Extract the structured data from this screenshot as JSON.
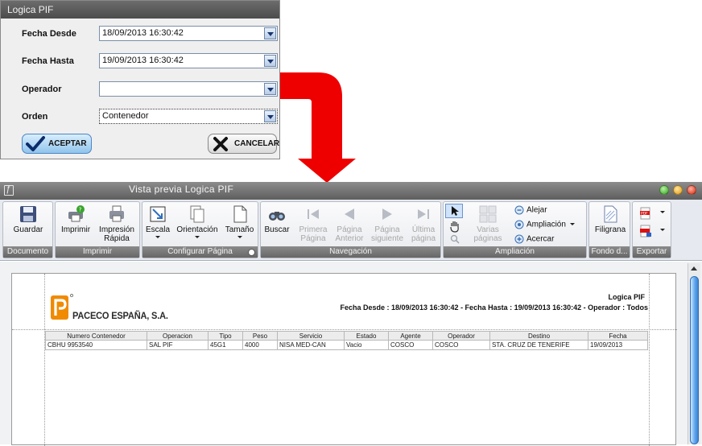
{
  "dialog": {
    "title": "Logica PIF",
    "fields": [
      {
        "label": "Fecha Desde",
        "value": "18/09/2013 16:30:42"
      },
      {
        "label": "Fecha Hasta",
        "value": "19/09/2013 16:30:42"
      },
      {
        "label": "Operador",
        "value": ""
      },
      {
        "label": "Orden",
        "value": "Contenedor"
      }
    ],
    "accept_label": "ACEPTAR",
    "cancel_label": "CANCELAR"
  },
  "preview": {
    "title": "Vista previa Logica PIF",
    "ribbon": {
      "groups": {
        "documento": "Documento",
        "imprimir": "Imprimir",
        "configurar": "Configurar Página",
        "navegacion": "Navegación",
        "ampliacion": "Ampliación",
        "fondo": "Fondo d...",
        "exportar": "Exportar"
      },
      "buttons": {
        "guardar": "Guardar",
        "imprimir": "Imprimir",
        "impresion_rapida_1": "Impresión",
        "impresion_rapida_2": "Rápida",
        "escala": "Escala",
        "orientacion": "Orientación",
        "tamano": "Tamaño",
        "buscar": "Buscar",
        "primera_1": "Primera",
        "primera_2": "Página",
        "anterior_1": "Página",
        "anterior_2": "Anterior",
        "siguiente_1": "Página",
        "siguiente_2": "siguiente",
        "ultima_1": "Última",
        "ultima_2": "página",
        "varias_1": "Varias",
        "varias_2": "páginas",
        "alejar": "Alejar",
        "ampliacion": "Ampliación",
        "acercar": "Acercar",
        "filigrana": "Filigrana"
      }
    },
    "report": {
      "company": "PACECO ESPAÑA, S.A.",
      "title": "Logica PIF",
      "subtitle": "Fecha Desde : 18/09/2013 16:30:42 - Fecha Hasta : 19/09/2013 16:30:42 - Operador : Todos",
      "columns": [
        "Numero Contenedor",
        "Operacion",
        "Tipo",
        "Peso",
        "Servicio",
        "Estado",
        "Agente",
        "Operador",
        "Destino",
        "Fecha"
      ],
      "rows": [
        [
          "CBHU 9953540",
          "SAL PIF",
          "45G1",
          "4000",
          "NISA MED-CAN",
          "Vacio",
          "COSCO",
          "COSCO",
          "STA. CRUZ DE TENERIFE",
          "19/09/2013"
        ]
      ]
    }
  },
  "colors": {
    "arrow": "#ee0000",
    "ribbon_title": "#6f6f6f",
    "accept": "#90c4ec"
  }
}
